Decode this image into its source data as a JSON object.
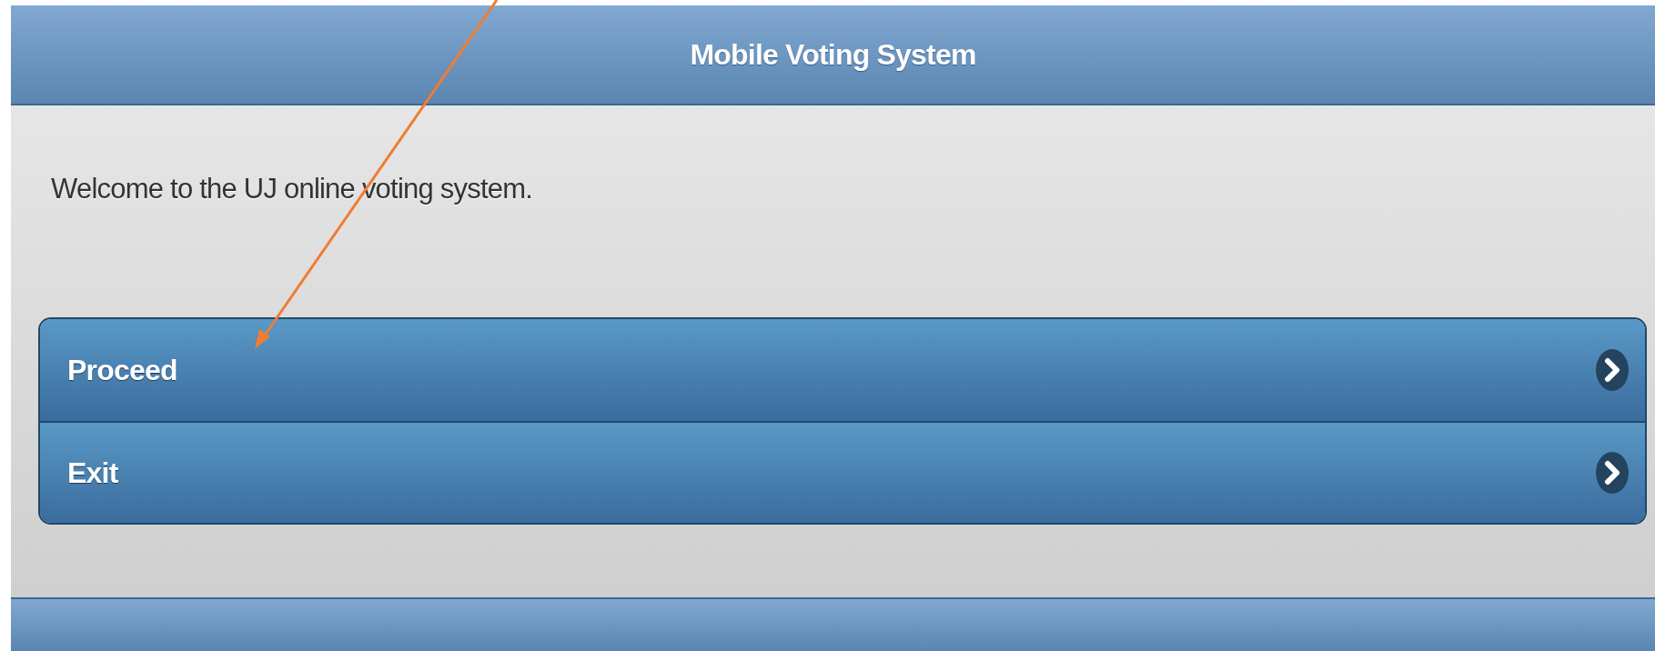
{
  "header": {
    "title": "Mobile Voting System"
  },
  "welcome": "Welcome to the UJ online voting system.",
  "menu": [
    {
      "label": "Proceed"
    },
    {
      "label": "Exit"
    }
  ]
}
